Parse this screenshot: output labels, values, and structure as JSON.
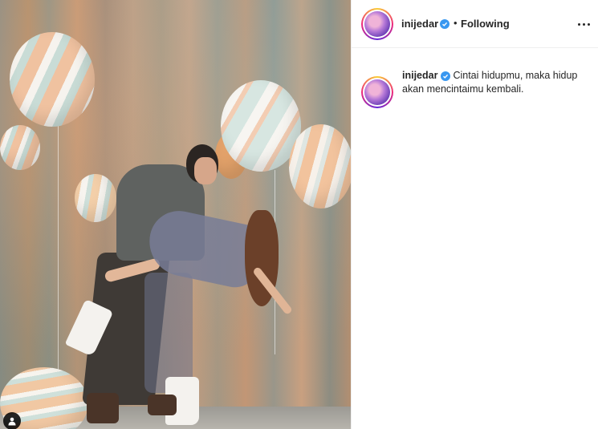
{
  "post": {
    "username": "inijedar",
    "follow_state": "Following",
    "separator": "•",
    "caption": "Cintai hidupmu, maka hidup akan mencintaimu kembali."
  },
  "icons": {
    "verified": "verified-badge-icon",
    "more": "more-options-icon",
    "tag": "user-tag-icon"
  },
  "colors": {
    "verified_blue": "#3897f0",
    "text": "#262626",
    "border": "#efefef"
  }
}
